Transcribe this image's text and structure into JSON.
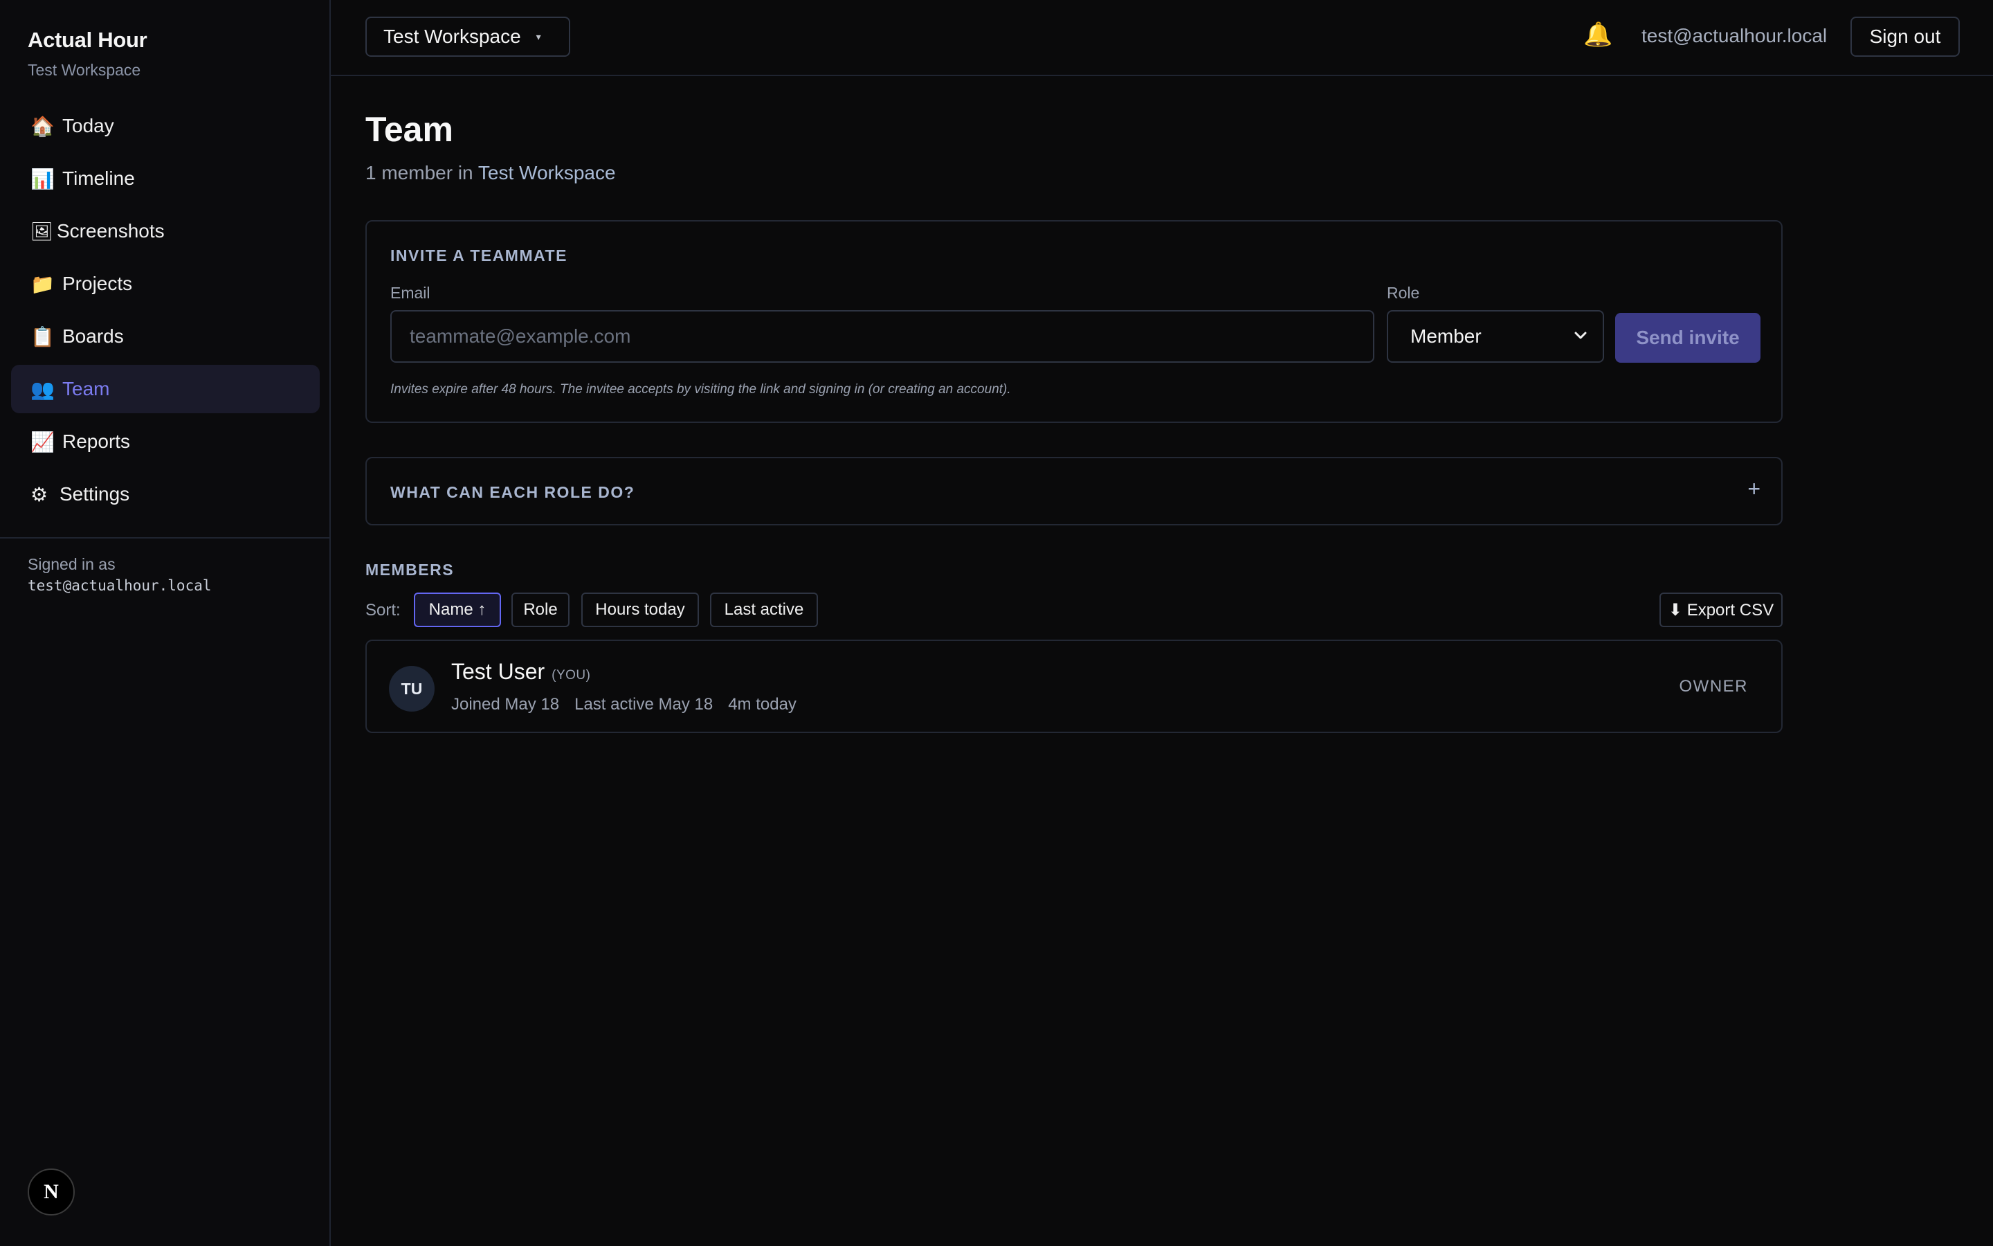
{
  "sidebar": {
    "brand_title": "Actual Hour",
    "brand_sub": "Test Workspace",
    "items": [
      {
        "label": "Today",
        "icon": "🏠",
        "icon_name": "house-icon"
      },
      {
        "label": "Timeline",
        "icon": "📊",
        "icon_name": "bar-chart-icon"
      },
      {
        "label": "Screenshots",
        "icon": "🖼",
        "icon_name": "picture-icon"
      },
      {
        "label": "Projects",
        "icon": "📁",
        "icon_name": "folder-icon"
      },
      {
        "label": "Boards",
        "icon": "📋",
        "icon_name": "clipboard-icon"
      },
      {
        "label": "Team",
        "icon": "👥",
        "icon_name": "people-icon"
      },
      {
        "label": "Reports",
        "icon": "📈",
        "icon_name": "trend-chart-icon"
      },
      {
        "label": "Settings",
        "icon": "⚙",
        "icon_name": "gear-icon"
      }
    ],
    "active": "Team",
    "signed_in_label": "Signed in as",
    "signed_in_email": "test@actualhour.local",
    "badge": "N"
  },
  "topbar": {
    "workspace": "Test Workspace",
    "caret": "▾",
    "bell": "🔔",
    "email": "test@actualhour.local",
    "signout": "Sign out"
  },
  "page": {
    "title": "Team",
    "subtitle_prefix": "1 member in ",
    "subtitle_workspace": "Test Workspace"
  },
  "invite": {
    "heading": "INVITE A TEAMMATE",
    "email_label": "Email",
    "email_placeholder": "teammate@example.com",
    "role_label": "Role",
    "role_value": "Member",
    "send": "Send invite",
    "hint": "Invites expire after 48 hours. The invitee accepts by visiting the link and signing in (or creating an account)."
  },
  "roles": {
    "heading": "WHAT CAN EACH ROLE DO?",
    "toggle": "+"
  },
  "members": {
    "heading": "MEMBERS",
    "sort_label": "Sort:",
    "sort_options": [
      "Name ↑",
      "Role",
      "Hours today",
      "Last active"
    ],
    "export": "⬇ Export CSV",
    "list": [
      {
        "initials": "TU",
        "name": "Test User",
        "you": "(YOU)",
        "joined": "Joined May 18",
        "last_active": "Last active May 18",
        "today": "4m today",
        "role": "OWNER"
      }
    ]
  },
  "colors": {
    "background": "#0a0a0b",
    "accent": "#6366f1",
    "active_nav_text": "#7c7cf0",
    "send_button": "#3b3a86"
  }
}
